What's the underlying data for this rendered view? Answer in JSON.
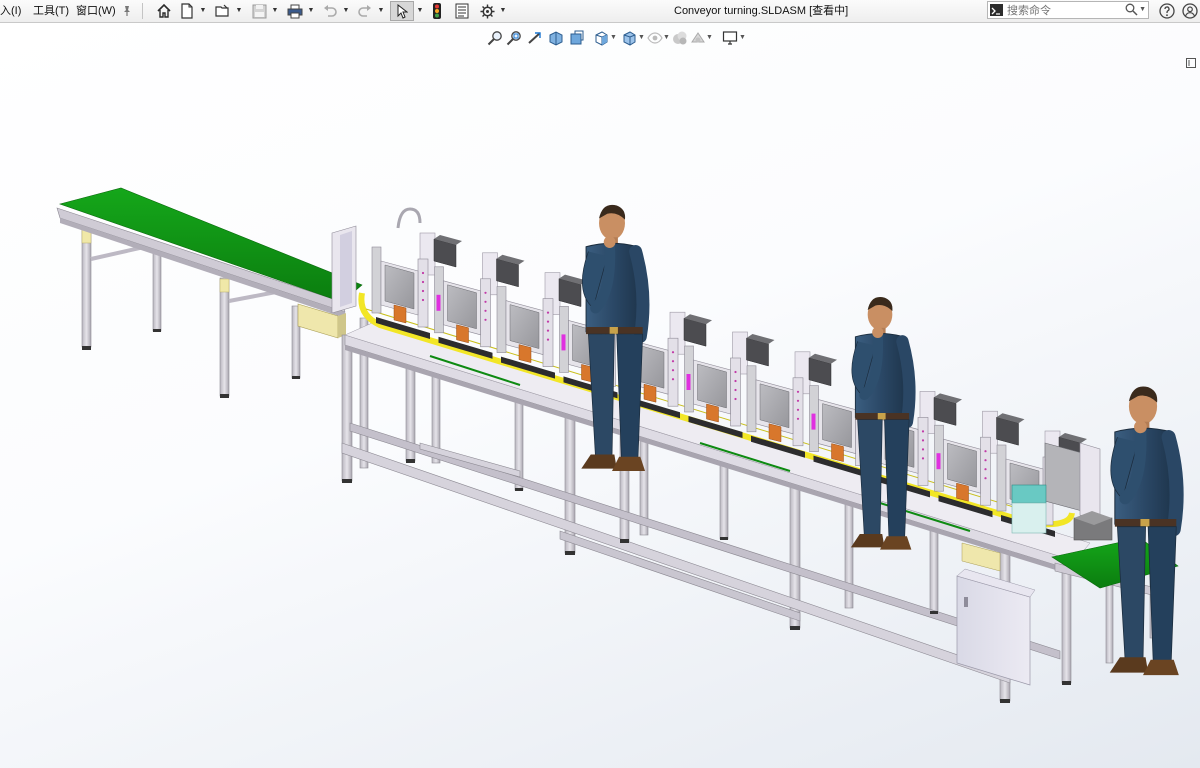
{
  "menu": {
    "insert_label": "入(I)",
    "tools_label": "工具(T)",
    "window_label": "窗口(W)"
  },
  "toolbar": {
    "icons": [
      "pin-icon",
      "home-icon",
      "new-document-icon",
      "open-folder-icon",
      "save-icon",
      "print-icon",
      "undo-icon",
      "redo-icon",
      "select-arrow-icon",
      "rebuild-traffic-light-icon",
      "file-properties-icon",
      "options-gear-icon"
    ]
  },
  "document": {
    "title": "Conveyor turning.SLDASM [查看中]"
  },
  "search": {
    "placeholder": "搜索命令"
  },
  "heads_up_view_toolbar": {
    "icons": [
      "zoom-to-fit-icon",
      "zoom-to-area-icon",
      "previous-view-icon",
      "section-view-icon",
      "view-orientation-icon",
      "display-style-icon",
      "hide-show-items-icon",
      "edit-appearance-icon",
      "apply-scene-icon",
      "view-settings-icon"
    ]
  },
  "colors": {
    "belt_green": "#0e8a12",
    "frame_aluminum": "#d3d0d8",
    "rail_yellow": "#f2e626",
    "station_panel": "#d2d2d6",
    "screen_gray": "#a9a9ad",
    "accent_orange": "#d8772c",
    "accent_magenta": "#e030e0",
    "worker_shirt": "#2d4a66",
    "background_gradient_end": "#e4e9f0"
  }
}
